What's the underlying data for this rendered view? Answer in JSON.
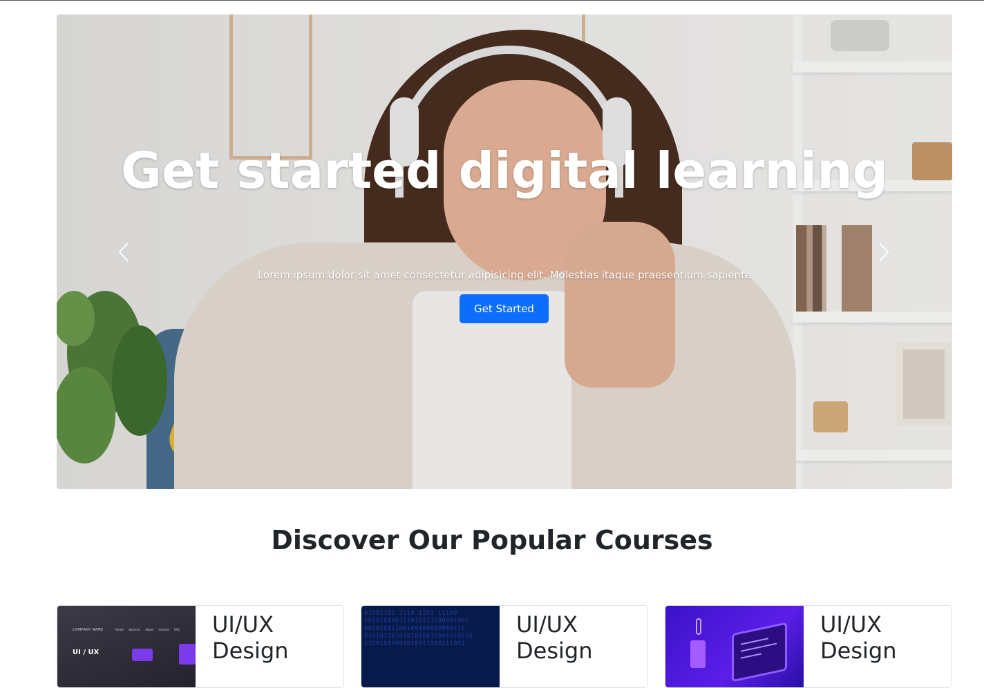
{
  "hero": {
    "title": "Get started digital learning",
    "subtitle": "Lorem ipsum dolor sit amet consectetur adipisicing elit. Molestias itaque praesentium sapiente",
    "cta_label": "Get Started",
    "prev_icon": "chevron-left-icon",
    "next_icon": "chevron-right-icon",
    "cta_color": "#0d6efd"
  },
  "courses_section": {
    "title": "Discover Our Popular Courses"
  },
  "courses": [
    {
      "title": "UI/UX Design",
      "thumb_nav_left": "COMPANY NAME",
      "thumb_nav_right": "Home Services About Contact FAQ",
      "thumb_label": "UI / UX"
    },
    {
      "title": "UI/UX Design",
      "thumb_binary": "01001101 1110 1101 11100\n101010100111010111100001001\n00101011100100100010000110\n0101011010101010011001010010\n11001010001010011010111001"
    },
    {
      "title": "UI/UX Design"
    }
  ]
}
